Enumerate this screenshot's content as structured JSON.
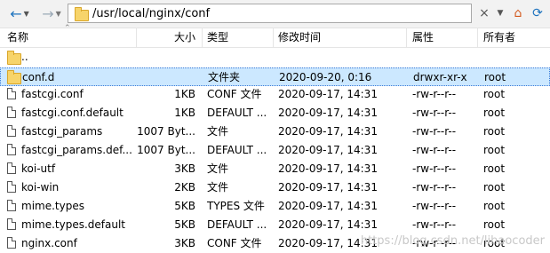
{
  "toolbar": {
    "path": "/usr/local/nginx/conf",
    "back_icon": "arrow-left",
    "forward_icon": "arrow-right",
    "clear_icon": "×",
    "refresh_icon": "refresh"
  },
  "columns": [
    "名称",
    "大小",
    "类型",
    "修改时间",
    "属性",
    "所有者"
  ],
  "rows": [
    {
      "name": "..",
      "size": "",
      "type": "",
      "modified": "",
      "attr": "",
      "owner": ""
    },
    {
      "name": "conf.d",
      "size": "",
      "type": "文件夹",
      "modified": "2020-09-20, 0:16",
      "attr": "drwxr-xr-x",
      "owner": "root"
    },
    {
      "name": "fastcgi.conf",
      "size": "1KB",
      "type": "CONF 文件",
      "modified": "2020-09-17, 14:31",
      "attr": "-rw-r--r--",
      "owner": "root"
    },
    {
      "name": "fastcgi.conf.default",
      "size": "1KB",
      "type": "DEFAULT ...",
      "modified": "2020-09-17, 14:31",
      "attr": "-rw-r--r--",
      "owner": "root"
    },
    {
      "name": "fastcgi_params",
      "size": "1007 Byt...",
      "type": "文件",
      "modified": "2020-09-17, 14:31",
      "attr": "-rw-r--r--",
      "owner": "root"
    },
    {
      "name": "fastcgi_params.def...",
      "size": "1007 Byt...",
      "type": "DEFAULT ...",
      "modified": "2020-09-17, 14:31",
      "attr": "-rw-r--r--",
      "owner": "root"
    },
    {
      "name": "koi-utf",
      "size": "3KB",
      "type": "文件",
      "modified": "2020-09-17, 14:31",
      "attr": "-rw-r--r--",
      "owner": "root"
    },
    {
      "name": "koi-win",
      "size": "2KB",
      "type": "文件",
      "modified": "2020-09-17, 14:31",
      "attr": "-rw-r--r--",
      "owner": "root"
    },
    {
      "name": "mime.types",
      "size": "5KB",
      "type": "TYPES 文件",
      "modified": "2020-09-17, 14:31",
      "attr": "-rw-r--r--",
      "owner": "root"
    },
    {
      "name": "mime.types.default",
      "size": "5KB",
      "type": "DEFAULT ...",
      "modified": "2020-09-17, 14:31",
      "attr": "-rw-r--r--",
      "owner": "root"
    },
    {
      "name": "nginx.conf",
      "size": "3KB",
      "type": "CONF 文件",
      "modified": "2020-09-17, 14:31",
      "attr": "-rw-r--r--",
      "owner": "root"
    }
  ],
  "watermark": "https://blog.csdn.net/lihaocoder"
}
